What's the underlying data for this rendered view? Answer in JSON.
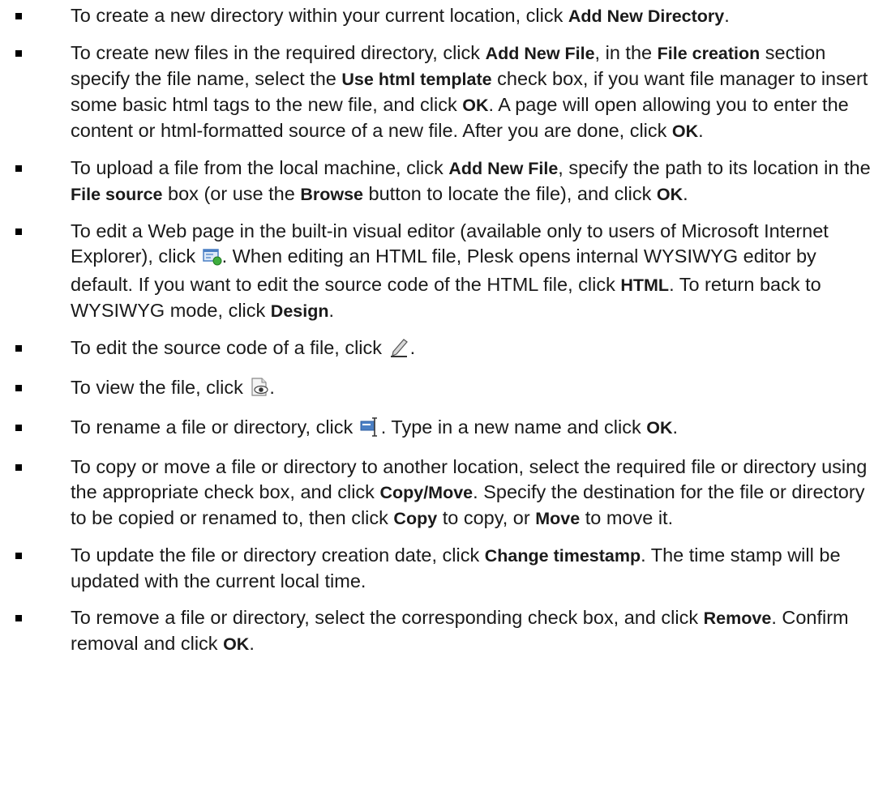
{
  "items": [
    {
      "t1": "To create a new directory within your current location, click ",
      "k1": "Add New Directory",
      "t2": "."
    },
    {
      "t1": "To create new files in the required directory, click ",
      "k1": "Add New File",
      "t2": ", in the ",
      "k2": "File creation",
      "t3": " section specify the file name, select the ",
      "k3": "Use html template",
      "t4": " check box, if you want file manager to insert some basic html tags to the new file, and click ",
      "k4": "OK",
      "t5": ". A page will open allowing you to enter the content or html-formatted source of a new file. After you are done, click ",
      "k5": "OK",
      "t6": "."
    },
    {
      "t1": "To upload a file from the local machine, click ",
      "k1": "Add New File",
      "t2": ", specify the path to its location in the ",
      "k2": "File source",
      "t3": " box (or use the ",
      "k3": "Browse",
      "t4": " button to locate the file), and click ",
      "k4": "OK",
      "t5": "."
    },
    {
      "t1": "To edit a Web page in the built-in visual editor (available only to users of Microsoft Internet Explorer), click ",
      "t2": ". When editing an HTML file, Plesk opens internal WYSIWYG editor by default. If you want to edit the source code of the HTML file, click ",
      "k1": "HTML",
      "t3": ". To return back to WYSIWYG mode, click ",
      "k2": "Design",
      "t4": "."
    },
    {
      "t1": "To edit the source code of a file, click ",
      "t2": "."
    },
    {
      "t1": "To view the file, click ",
      "t2": "."
    },
    {
      "t1": "To rename a file or directory, click ",
      "t2": ". Type in a new name and click ",
      "k1": "OK",
      "t3": "."
    },
    {
      "t1": "To copy or move a file or directory to another location, select the required file or directory using the appropriate check box, and click ",
      "k1": "Copy/Move",
      "t2": ". Specify the destination for the file or directory to be copied or renamed to, then click ",
      "k2": "Copy",
      "t3": " to copy, or ",
      "k3": "Move",
      "t4": " to move it."
    },
    {
      "t1": "To update the file or directory creation date, click ",
      "k1": "Change timestamp",
      "t2": ". The time stamp will be updated with the current local time."
    },
    {
      "t1": "To remove a file or directory, select the corresponding check box, and click ",
      "k1": "Remove",
      "t2": ". Confirm removal and click ",
      "k2": "OK",
      "t3": "."
    }
  ],
  "icons": {
    "visual_editor": "visual-editor-icon",
    "edit_source": "pencil-icon",
    "view": "view-file-icon",
    "rename": "rename-icon"
  }
}
